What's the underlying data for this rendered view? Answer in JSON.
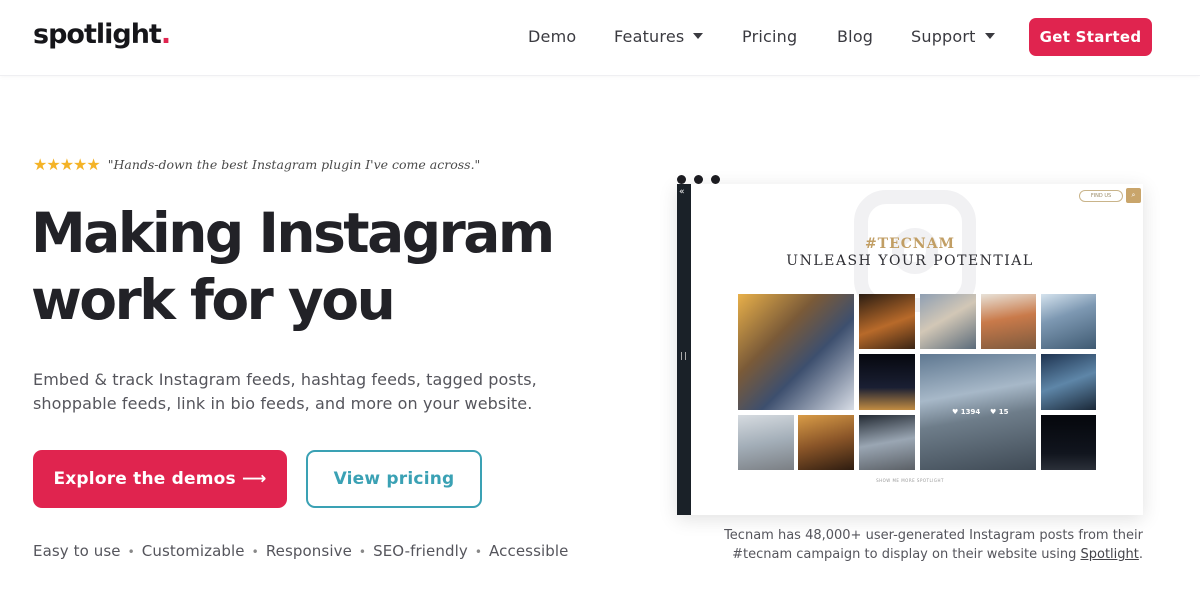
{
  "header": {
    "logo_text": "spotlight",
    "logo_dot": ".",
    "nav": [
      {
        "label": "Demo",
        "dropdown": false
      },
      {
        "label": "Features",
        "dropdown": true
      },
      {
        "label": "Pricing",
        "dropdown": false
      },
      {
        "label": "Blog",
        "dropdown": false
      },
      {
        "label": "Support",
        "dropdown": true
      }
    ],
    "cta_label": "Get Started"
  },
  "hero": {
    "rating_stars": "★★★★★",
    "review_quote": "\"Hands-down the best Instagram plugin I've come across.\"",
    "headline_line1": "Making Instagram",
    "headline_line2": "work for you",
    "subtext": "Embed & track Instagram feeds, hashtag feeds, tagged posts, shoppable feeds, link in bio feeds, and more on your website.",
    "primary_button": "Explore the demos  ⟶",
    "secondary_button": "View pricing",
    "features": [
      "Easy to use",
      "Customizable",
      "Responsive",
      "SEO-friendly",
      "Accessible"
    ]
  },
  "demo": {
    "find_us_label": "FIND US",
    "hashtag": "#TECNAM",
    "tagline": "UNLEASH YOUR POTENTIAL",
    "featured_likes": "1394",
    "featured_comments": "15",
    "footer_text": "SHOW ME MORE SPOTLIGHT",
    "caption_prefix": "Tecnam has 48,000+ user-generated Instagram posts from their #tecnam campaign to display on their website using ",
    "caption_link": "Spotlight",
    "caption_suffix": "."
  },
  "colors": {
    "brand_red": "#e0244f",
    "teal": "#3aa1b4",
    "star_gold": "#f4b327",
    "hashtag_gold": "#c19e64"
  }
}
